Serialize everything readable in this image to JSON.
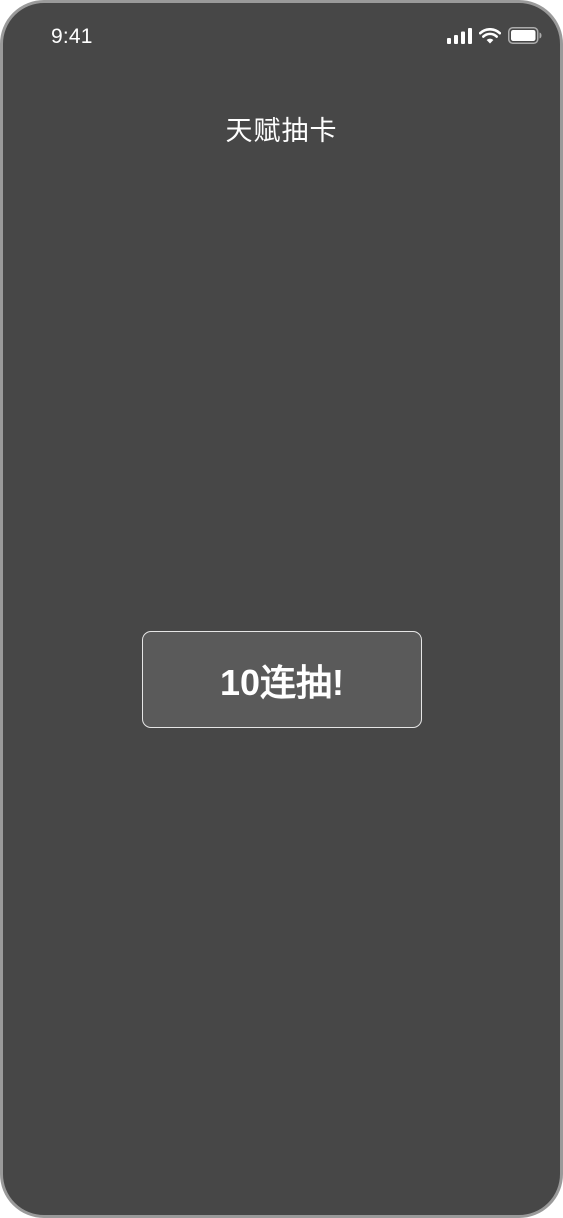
{
  "status_bar": {
    "time": "9:41",
    "icons": [
      "cellular-signal-icon",
      "wifi-icon",
      "battery-icon"
    ]
  },
  "header": {
    "title": "天赋抽卡"
  },
  "main": {
    "draw_button_label": "10连抽!"
  },
  "colors": {
    "background": "#474747",
    "button_fill": "#5a5a5a",
    "button_border": "#e6e6e6",
    "text": "#ffffff",
    "device_frame": "#9a9a9a"
  }
}
